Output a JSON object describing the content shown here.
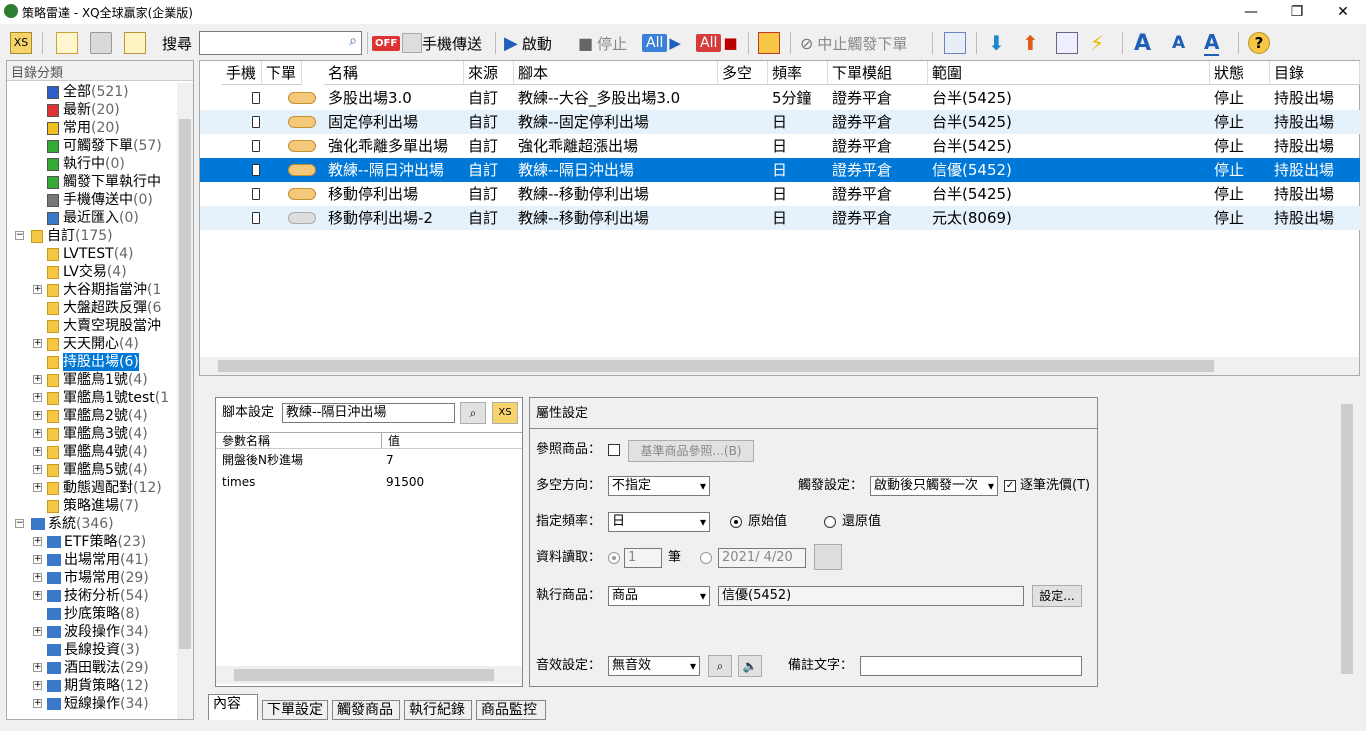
{
  "window": {
    "title": "策略雷達 - XQ全球贏家(企業版)",
    "minimize": "—",
    "restore": "❐",
    "close": "✕"
  },
  "toolbar": {
    "search_label": "搜尋",
    "phone_send": "手機傳送",
    "start": "啟動",
    "stop": "停止",
    "all_start": "All",
    "all_stop": "All",
    "stop_trigger": "中止觸發下單",
    "off_badge": "OFF",
    "xs_label": "XS"
  },
  "tree": {
    "header": "目錄分類",
    "items": [
      {
        "label": "全部",
        "count": "(521)"
      },
      {
        "label": "最新",
        "count": "(20)"
      },
      {
        "label": "常用",
        "count": "(20)"
      },
      {
        "label": "可觸發下單",
        "count": "(57)"
      },
      {
        "label": "執行中",
        "count": "(0)"
      },
      {
        "label": "觸發下單執行中",
        "count": ""
      },
      {
        "label": "手機傳送中",
        "count": "(0)"
      },
      {
        "label": "最近匯入",
        "count": "(0)"
      },
      {
        "label": "自訂",
        "count": "(175)"
      },
      {
        "label": "LVTEST",
        "count": "(4)"
      },
      {
        "label": "LV交易",
        "count": "(4)"
      },
      {
        "label": "大谷期指當沖",
        "count": "(1"
      },
      {
        "label": "大盤超跌反彈",
        "count": "(6"
      },
      {
        "label": "大賣空現股當沖",
        "count": ""
      },
      {
        "label": "天天開心",
        "count": "(4)"
      },
      {
        "label": "持股出場",
        "count": "(6)"
      },
      {
        "label": "軍艦鳥1號",
        "count": "(4)"
      },
      {
        "label": "軍艦鳥1號test",
        "count": "(1"
      },
      {
        "label": "軍艦鳥2號",
        "count": "(4)"
      },
      {
        "label": "軍艦鳥3號",
        "count": "(4)"
      },
      {
        "label": "軍艦鳥4號",
        "count": "(4)"
      },
      {
        "label": "軍艦鳥5號",
        "count": "(4)"
      },
      {
        "label": "動態週配對",
        "count": "(12)"
      },
      {
        "label": "策略進場",
        "count": "(7)"
      },
      {
        "label": "系統",
        "count": "(346)"
      },
      {
        "label": "ETF策略",
        "count": "(23)"
      },
      {
        "label": "出場常用",
        "count": "(41)"
      },
      {
        "label": "市場常用",
        "count": "(29)"
      },
      {
        "label": "技術分析",
        "count": "(54)"
      },
      {
        "label": "抄底策略",
        "count": "(8)"
      },
      {
        "label": "波段操作",
        "count": "(34)"
      },
      {
        "label": "長線投資",
        "count": "(3)"
      },
      {
        "label": "酒田戰法",
        "count": "(29)"
      },
      {
        "label": "期貨策略",
        "count": "(12)"
      },
      {
        "label": "短線操作",
        "count": "(34)"
      }
    ]
  },
  "grid": {
    "columns": [
      "手機",
      "下單",
      "名稱",
      "來源",
      "腳本",
      "多空",
      "頻率",
      "下單模組",
      "範圍",
      "狀態",
      "目錄"
    ],
    "rows": [
      {
        "name": "多股出場3.0",
        "source": "自訂",
        "script": "教練--大谷_多股出場3.0",
        "side": "",
        "freq": "5分鐘",
        "module": "證券平倉",
        "range": "台半(5425)",
        "status": "停止",
        "dir": "持股出場"
      },
      {
        "name": "固定停利出場",
        "source": "自訂",
        "script": "教練--固定停利出場",
        "side": "",
        "freq": "日",
        "module": "證券平倉",
        "range": "台半(5425)",
        "status": "停止",
        "dir": "持股出場"
      },
      {
        "name": "強化乖離多單出場",
        "source": "自訂",
        "script": "強化乖離超漲出場",
        "side": "",
        "freq": "日",
        "module": "證券平倉",
        "range": "台半(5425)",
        "status": "停止",
        "dir": "持股出場"
      },
      {
        "name": "教練--隔日沖出場",
        "source": "自訂",
        "script": "教練--隔日沖出場",
        "side": "",
        "freq": "日",
        "module": "證券平倉",
        "range": "信優(5452)",
        "status": "停止",
        "dir": "持股出場"
      },
      {
        "name": "移動停利出場",
        "source": "自訂",
        "script": "教練--移動停利出場",
        "side": "",
        "freq": "日",
        "module": "證券平倉",
        "range": "台半(5425)",
        "status": "停止",
        "dir": "持股出場"
      },
      {
        "name": "移動停利出場-2",
        "source": "自訂",
        "script": "教練--移動停利出場",
        "side": "",
        "freq": "日",
        "module": "證券平倉",
        "range": "元太(8069)",
        "status": "停止",
        "dir": "持股出場"
      }
    ]
  },
  "script_panel": {
    "label": "腳本設定",
    "value": "教練--隔日沖出場",
    "col_name": "參數名稱",
    "col_value": "值",
    "params": [
      {
        "name": "開盤後N秒進場",
        "value": "7"
      },
      {
        "name": "times",
        "value": "91500"
      }
    ]
  },
  "props": {
    "title": "屬性設定",
    "ref_label": "參照商品：",
    "ref_btn": "基準商品參照...(B)",
    "side_label": "多空方向：",
    "side_value": "不指定",
    "trigger_label": "觸發設定：",
    "trigger_value": "啟動後只觸發一次",
    "wash_label": "逐筆洗價(T)",
    "freq_label": "指定頻率：",
    "freq_value": "日",
    "orig_label": "原始值",
    "restore_label": "還原值",
    "data_label": "資料讀取：",
    "bars_value": "1",
    "bars_unit": "筆",
    "date_value": "2021/ 4/20",
    "exec_label": "執行商品：",
    "exec_value": "商品",
    "exec_target": "信優(5452)",
    "set_btn": "設定...",
    "sound_label": "音效設定：",
    "sound_value": "無音效",
    "note_label": "備註文字：",
    "note_value": ""
  },
  "tabs": [
    "內容",
    "下單設定",
    "觸發商品",
    "執行紀錄",
    "商品監控"
  ]
}
